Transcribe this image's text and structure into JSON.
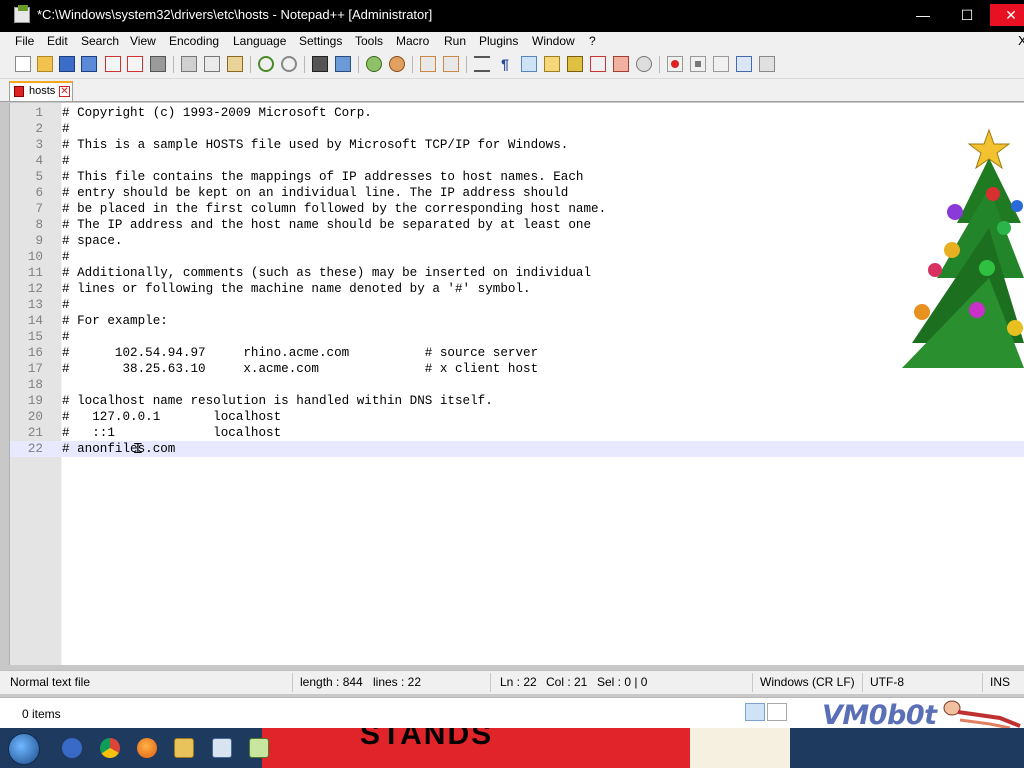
{
  "window": {
    "title": "*C:\\Windows\\system32\\drivers\\etc\\hosts - Notepad++ [Administrator]",
    "controls": {
      "minimize": "—",
      "maximize": "☐",
      "close": "✕"
    }
  },
  "menu": [
    "File",
    "Edit",
    "Search",
    "View",
    "Encoding",
    "Language",
    "Settings",
    "Tools",
    "Macro",
    "Run",
    "Plugins",
    "Window",
    "?"
  ],
  "menu_close": "X",
  "tab": {
    "label": "hosts",
    "close": "✕"
  },
  "editor": {
    "current_line": 22,
    "lines": [
      {
        "n": "1",
        "text": "# Copyright (c) 1993-2009 Microsoft Corp."
      },
      {
        "n": "2",
        "text": "#"
      },
      {
        "n": "3",
        "text": "# This is a sample HOSTS file used by Microsoft TCP/IP for Windows."
      },
      {
        "n": "4",
        "text": "#"
      },
      {
        "n": "5",
        "text": "# This file contains the mappings of IP addresses to host names. Each"
      },
      {
        "n": "6",
        "text": "# entry should be kept on an individual line. The IP address should"
      },
      {
        "n": "7",
        "text": "# be placed in the first column followed by the corresponding host name."
      },
      {
        "n": "8",
        "text": "# The IP address and the host name should be separated by at least one"
      },
      {
        "n": "9",
        "text": "# space."
      },
      {
        "n": "10",
        "text": "#"
      },
      {
        "n": "11",
        "text": "# Additionally, comments (such as these) may be inserted on individual"
      },
      {
        "n": "12",
        "text": "# lines or following the machine name denoted by a '#' symbol."
      },
      {
        "n": "13",
        "text": "#"
      },
      {
        "n": "14",
        "text": "# For example:"
      },
      {
        "n": "15",
        "text": "#"
      },
      {
        "n": "16",
        "text": "#      102.54.94.97     rhino.acme.com          # source server"
      },
      {
        "n": "17",
        "text": "#       38.25.63.10     x.acme.com              # x client host"
      },
      {
        "n": "18",
        "text": ""
      },
      {
        "n": "19",
        "text": "# localhost name resolution is handled within DNS itself."
      },
      {
        "n": "20",
        "text": "#   127.0.0.1       localhost"
      },
      {
        "n": "21",
        "text": "#   ::1             localhost"
      },
      {
        "n": "22",
        "text": "# anonfiles.com"
      }
    ]
  },
  "status": {
    "file_type": "Normal text file",
    "length": "length : 844",
    "lines": "lines : 22",
    "ln": "Ln : 22",
    "col": "Col : 21",
    "sel": "Sel : 0 | 0",
    "eol": "Windows (CR LF)",
    "encoding": "UTF-8",
    "mode": "INS"
  },
  "explorer": {
    "items": "0 items"
  },
  "watermark": "VM0b0t",
  "wallpaper_text": "STANDS",
  "colors": {
    "close_red": "#e81123",
    "tab_accent": "#f5a623",
    "current_line": "#e8e8ff",
    "wallpaper_red": "#e0242a"
  },
  "icons": {
    "toolbar": [
      "new-file-icon",
      "open-file-icon",
      "save-icon",
      "save-all-icon",
      "close-icon",
      "close-all-icon",
      "print-icon",
      "cut-icon",
      "copy-icon",
      "paste-icon",
      "undo-icon",
      "redo-icon",
      "find-icon",
      "replace-icon",
      "zoom-in-icon",
      "zoom-out-icon",
      "sync-vertical-icon",
      "sync-horizontal-icon",
      "word-wrap-icon",
      "show-all-chars-icon",
      "indent-guide-icon",
      "user-language-icon",
      "doc-map-icon",
      "function-list-icon",
      "folder-workspace-icon",
      "monitor-icon",
      "record-macro-icon",
      "stop-macro-icon",
      "play-macro-icon",
      "run-macro-multiple-icon",
      "save-macro-icon"
    ],
    "taskbar": [
      "start-orb-icon",
      "ie-icon",
      "chrome-icon",
      "firefox-icon",
      "explorer-icon",
      "app-icon",
      "notepadpp-icon"
    ]
  }
}
